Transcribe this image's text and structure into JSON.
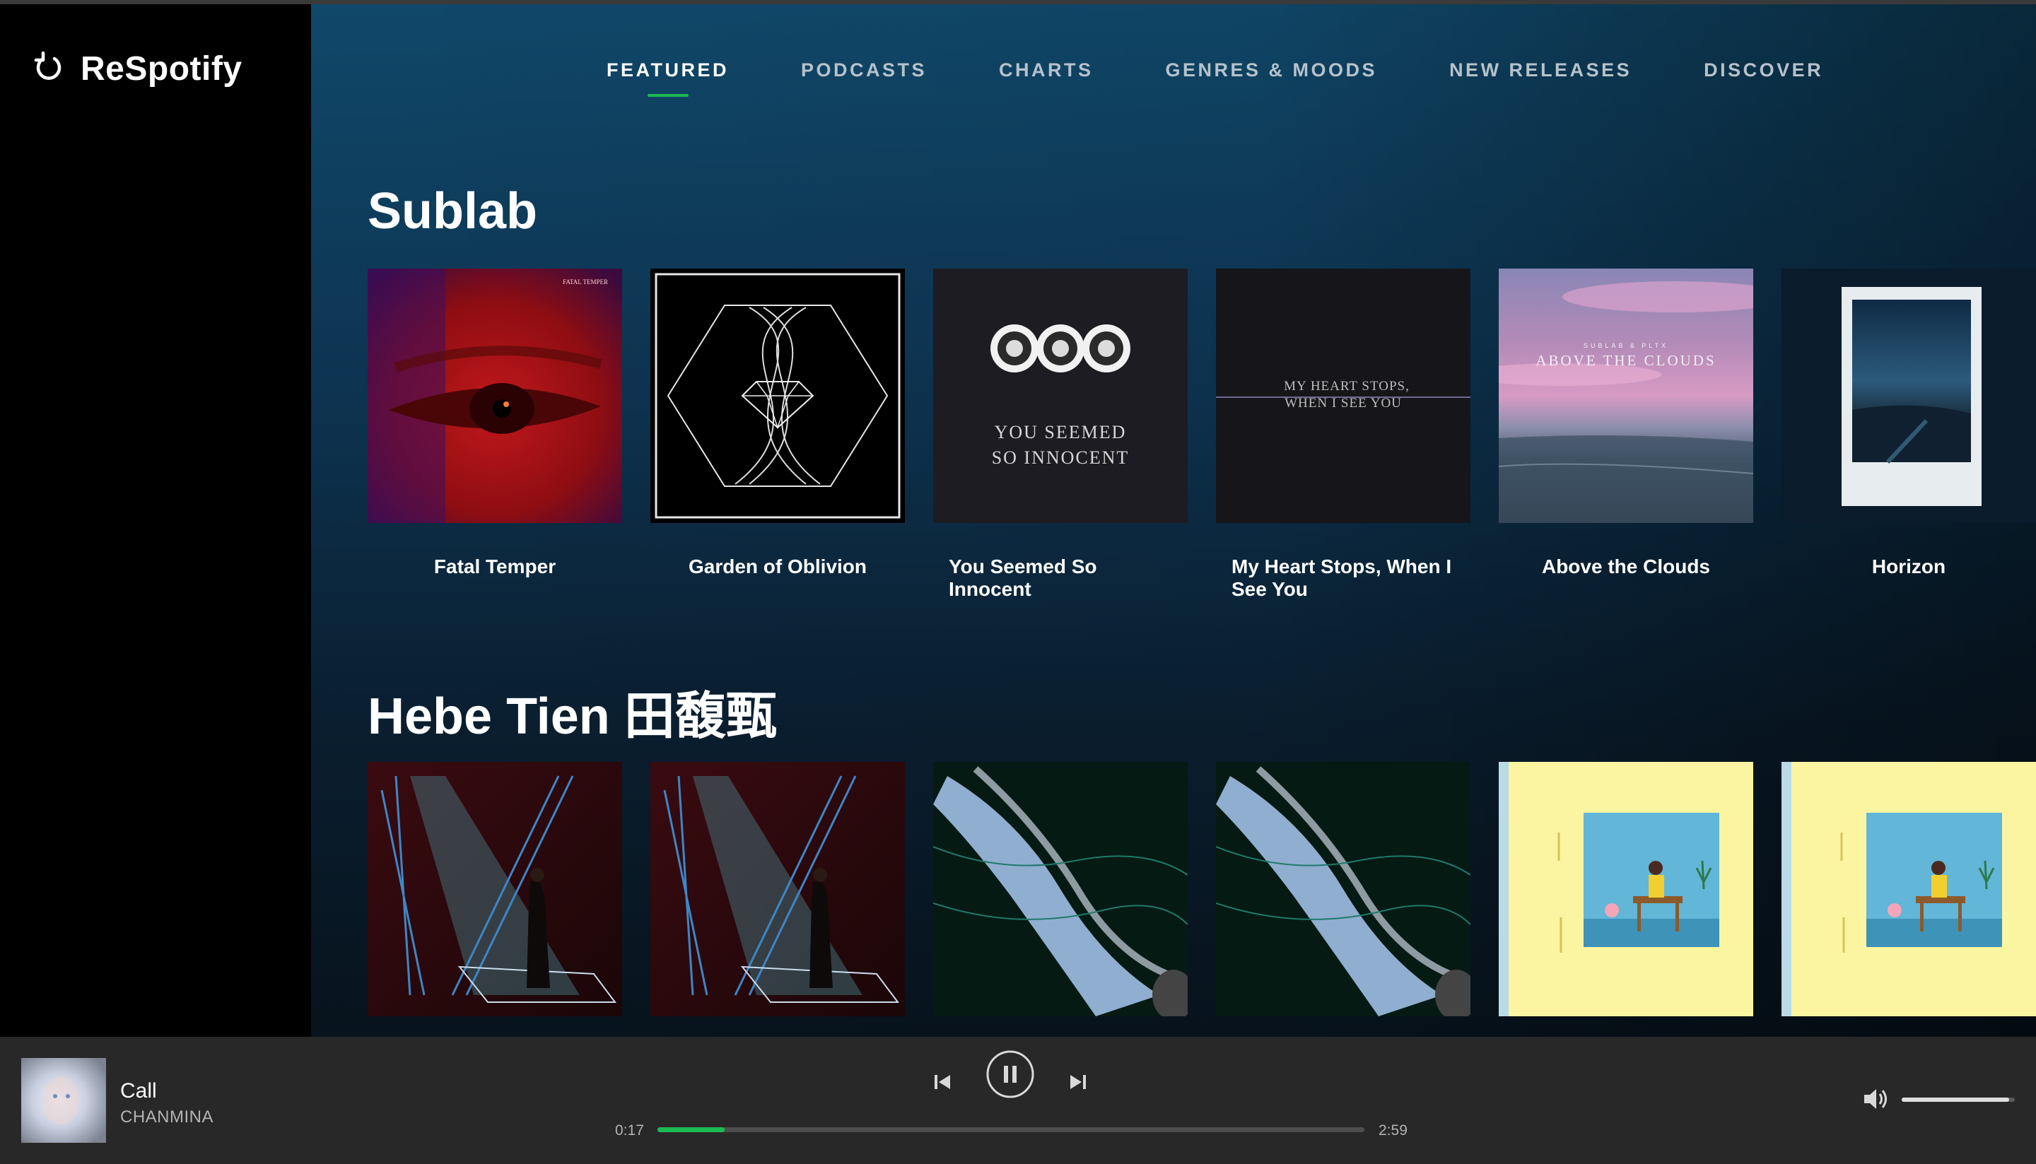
{
  "app": {
    "brand": "ReSpotify",
    "brand_icon": "refresh-icon"
  },
  "nav": {
    "tabs": [
      {
        "label": "FEATURED",
        "active": true
      },
      {
        "label": "PODCASTS",
        "active": false
      },
      {
        "label": "CHARTS",
        "active": false
      },
      {
        "label": "GENRES & MOODS",
        "active": false
      },
      {
        "label": "NEW RELEASES",
        "active": false
      },
      {
        "label": "DISCOVER",
        "active": false
      }
    ]
  },
  "sections": [
    {
      "title": "Sublab",
      "albums": [
        {
          "title": "Fatal Temper",
          "cover_text": "FATAL TEMPER"
        },
        {
          "title": "Garden of Oblivion"
        },
        {
          "title": "You Seemed So Innocent",
          "cover_text": [
            "YOU SEEMED",
            "SO INNOCENT"
          ]
        },
        {
          "title": "My Heart Stops, When I See You",
          "cover_text": [
            "MY HEART STOPS,",
            "WHEN I SEE YOU"
          ]
        },
        {
          "title": "Above the Clouds",
          "cover_text": [
            "SUBLAB & PLTX",
            "ABOVE THE CLOUDS"
          ]
        },
        {
          "title": "Horizon"
        }
      ]
    },
    {
      "title": "Hebe Tien 田馥甄",
      "albums": [
        {
          "title": ""
        },
        {
          "title": ""
        },
        {
          "title": ""
        },
        {
          "title": ""
        },
        {
          "title": ""
        },
        {
          "title": ""
        }
      ]
    }
  ],
  "player": {
    "track": "Call",
    "artist": "CHANMINA",
    "elapsed": "0:17",
    "duration": "2:59",
    "progress": 0.095,
    "volume": 0.95,
    "state": "playing",
    "icons": [
      "previous-icon",
      "pause-icon",
      "next-icon",
      "volume-icon"
    ]
  },
  "colors": {
    "accent": "#1db954",
    "player_bg": "#282828",
    "sidebar_bg": "#000000"
  }
}
